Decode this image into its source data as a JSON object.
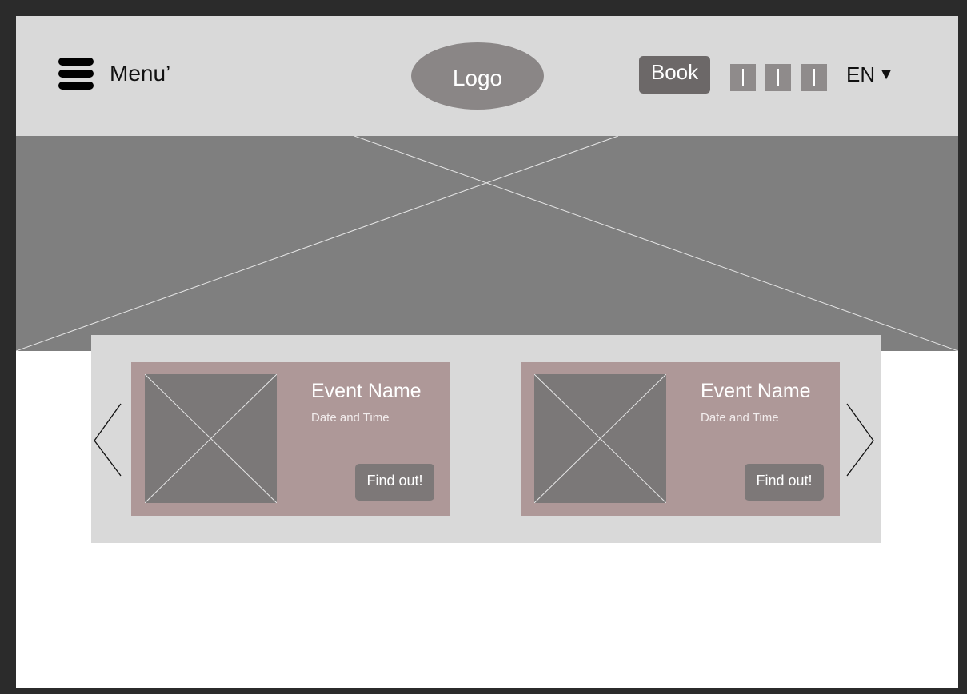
{
  "header": {
    "menu_label": "Menu’",
    "menu_icon": "hamburger-icon",
    "logo_text": "Logo",
    "book_label": "Book",
    "social_icons": [
      "social-icon",
      "social-icon",
      "social-icon"
    ],
    "language": "EN",
    "language_caret": "▼"
  },
  "hero": {
    "image": "image-placeholder"
  },
  "events": {
    "prev_icon": "chevron-left-icon",
    "next_icon": "chevron-right-icon",
    "cards": [
      {
        "name": "Event Name",
        "datetime": "Date and Time",
        "button_label": "Find out!",
        "image": "image-placeholder"
      },
      {
        "name": "Event Name",
        "datetime": "Date and Time",
        "button_label": "Find out!",
        "image": "image-placeholder"
      }
    ]
  },
  "colors": {
    "header_bg": "#d9d9d9",
    "hero_bg": "#7f7f7f",
    "card_bg": "#ae9898",
    "logo_bg": "#8a8686",
    "button_bg": "#6c6868"
  }
}
